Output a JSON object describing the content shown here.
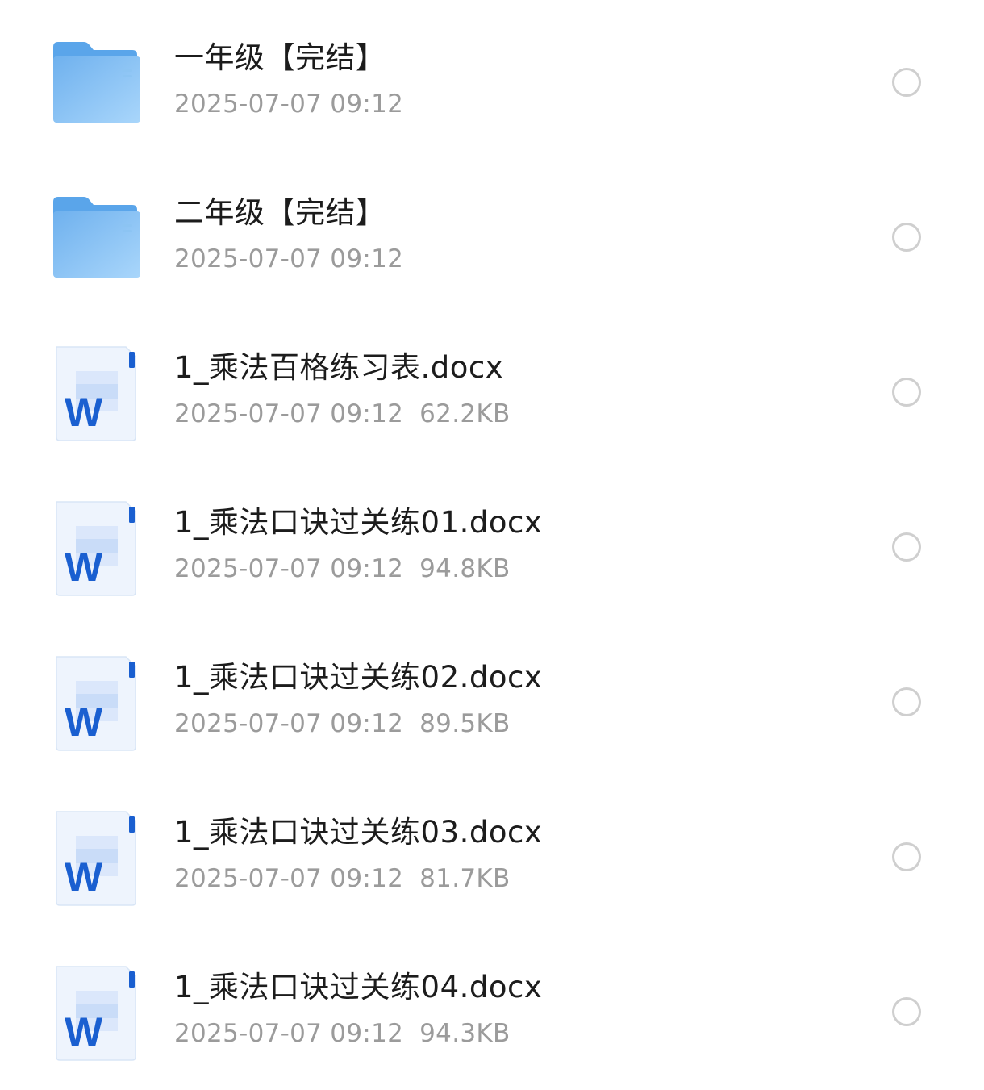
{
  "files": [
    {
      "type": "folder",
      "icon": "folder-icon",
      "name": "一年级【完结】",
      "date": "2025-07-07 09:12",
      "size": ""
    },
    {
      "type": "folder",
      "icon": "folder-icon",
      "name": "二年级【完结】",
      "date": "2025-07-07 09:12",
      "size": ""
    },
    {
      "type": "docx",
      "icon": "word-doc-icon",
      "name": "1_乘法百格练习表.docx",
      "date": "2025-07-07 09:12",
      "size": "62.2KB"
    },
    {
      "type": "docx",
      "icon": "word-doc-icon",
      "name": "1_乘法口诀过关练01.docx",
      "date": "2025-07-07 09:12",
      "size": "94.8KB"
    },
    {
      "type": "docx",
      "icon": "word-doc-icon",
      "name": "1_乘法口诀过关练02.docx",
      "date": "2025-07-07 09:12",
      "size": "89.5KB"
    },
    {
      "type": "docx",
      "icon": "word-doc-icon",
      "name": "1_乘法口诀过关练03.docx",
      "date": "2025-07-07 09:12",
      "size": "81.7KB"
    },
    {
      "type": "docx",
      "icon": "word-doc-icon",
      "name": "1_乘法口诀过关练04.docx",
      "date": "2025-07-07 09:12",
      "size": "94.3KB"
    }
  ],
  "colors": {
    "folder": "#7dbdf2",
    "word_blue": "#1a5fd0",
    "name_text": "#1c1c1c",
    "meta_text": "#9b9b9b",
    "circle_border": "#cfcfcf"
  }
}
